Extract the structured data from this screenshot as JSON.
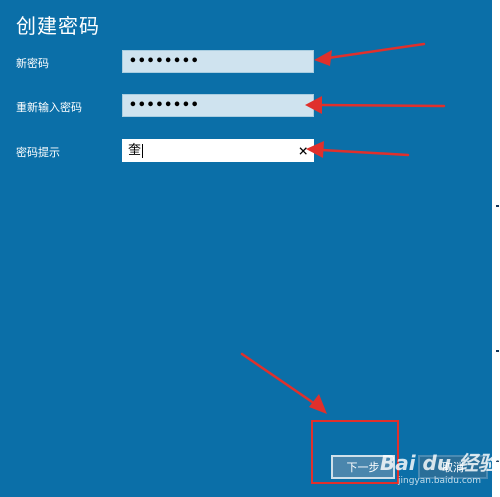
{
  "dialog": {
    "title": "创建密码",
    "fields": [
      {
        "label": "新密码",
        "value": "••••••••"
      },
      {
        "label": "重新输入密码",
        "value": "••••••••"
      },
      {
        "label": "密码提示",
        "value": "奎"
      }
    ],
    "clear_icon": "×",
    "next_button": "下一步",
    "cancel_button": "取消"
  },
  "watermark": {
    "logo": "Bai du 经验",
    "url": "jingyan.baidu.com"
  },
  "colors": {
    "background": "#0b6fa8",
    "annotation": "#e0302c"
  }
}
